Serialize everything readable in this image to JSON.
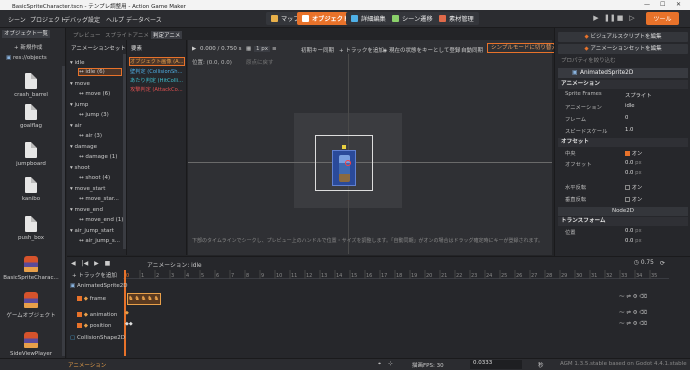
{
  "window": {
    "title": "BasicSpriteCharacter.tscn - テンプレ調整用 - Action Game Maker"
  },
  "menu": [
    "シーン",
    "プロジェクト",
    "デバッグ",
    "設定",
    "ヘルプ",
    "データベース"
  ],
  "top_tabs": [
    {
      "label": "マップ",
      "color": "#e8b04a"
    },
    {
      "label": "オブジェクト",
      "color": "#ffffff",
      "active": true
    },
    {
      "label": "詳細編集",
      "color": "#4fb0e6"
    },
    {
      "label": "シーン遷移",
      "color": "#8ad06a"
    },
    {
      "label": "素材管理",
      "color": "#e06a4a"
    }
  ],
  "run_button": "ツール",
  "left_dock": {
    "tab": "オブジェクト一覧",
    "new_button": "+ 新規作成",
    "path": "res://objects",
    "objects": [
      "crash_barrel",
      "goalflag",
      "jumpboard",
      "kanibo",
      "push_box",
      "BasicSpriteCharac...",
      "ゲームオブジェクト",
      "SideViewPlayer"
    ]
  },
  "sub_tabs": [
    "プレビュー",
    "スプライトアニメ",
    "判定アニメ"
  ],
  "animset": {
    "header": "アニメーションセット",
    "groups": [
      {
        "name": "idle",
        "item": "idle (6)",
        "selected": true
      },
      {
        "name": "move",
        "item": "move (6)"
      },
      {
        "name": "jump",
        "item": "jump (3)"
      },
      {
        "name": "air",
        "item": "air (3)"
      },
      {
        "name": "damage",
        "item": "damage (1)"
      },
      {
        "name": "shoot",
        "item": "shoot (4)"
      },
      {
        "name": "move_start",
        "item": "move_star..."
      },
      {
        "name": "move_end",
        "item": "move_end (1)"
      },
      {
        "name": "air_jump_start",
        "item": "air_jump_s..."
      }
    ]
  },
  "elements": {
    "header": "要素",
    "rows": [
      {
        "label": "オブジェクト画像 (A...",
        "color": "#e8a04a",
        "selected": true
      },
      {
        "label": "壁判定 (CollisionSh...",
        "color": "#4fb0e6"
      },
      {
        "label": "あたり判定 (HitColli...",
        "color": "#3ec0d0"
      },
      {
        "label": "攻撃判定 (AttackCo...",
        "color": "#e05050"
      }
    ]
  },
  "viewport": {
    "time": "0.000 / 0.750 s",
    "px": "1 px",
    "init_sync": "初期キー同期",
    "add_track": "+ トラックを追加",
    "register_key": "現在の状態をキーとして登録",
    "auto_sync": "自動同期",
    "simple_mode": "シンプルモードに切り替え",
    "position_label": "位置:",
    "position_value": "(0.0, 0.0)",
    "reset": "原点に戻す",
    "hint": "下部のタイムラインでシークし、プレビュー上のハンドルで位置・サイズを調整します。「自動同期」がオンの場合はドラッグ確定時にキーが登録されます。"
  },
  "right_dock": {
    "visual_script": "ビジュアルスクリプトを編集",
    "animset_edit": "アニメーションセットを編集",
    "filter": "プロパティを絞り込む",
    "node": "AnimatedSprite2D",
    "sections": {
      "animation": "アニメーション",
      "offset": "オフセット",
      "node2d": "Node2D",
      "transform": "トランスフォーム"
    },
    "props": {
      "sprite_frames_label": "Sprite Frames",
      "sprite_frames": "スプライト",
      "animation_label": "アニメーション",
      "animation": "idle",
      "frame_label": "フレーム",
      "frame": "0",
      "speed_label": "スピードスケール",
      "speed": "1.0",
      "center_label": "中央",
      "center": "オン",
      "offset_label": "オフセット",
      "offset_x": "0.0",
      "offset_y": "0.0",
      "fliph_label": "水平反転",
      "fliph": "オン",
      "flipv_label": "垂直反転",
      "flipv": "オン",
      "pos_label": "位置",
      "pos_x": "0.0",
      "pos_y": "0.0",
      "unit": "px"
    }
  },
  "timeline": {
    "add_track": "+ トラックを追加",
    "anim_label": "アニメーション:",
    "anim_name": "idle",
    "length": "0.75",
    "ruler": [
      "0",
      "1",
      "2",
      "3",
      "4",
      "5",
      "6",
      "7",
      "8",
      "9",
      "10",
      "11",
      "12",
      "13",
      "14",
      "15",
      "16",
      "17",
      "18",
      "19",
      "20",
      "21",
      "22",
      "23",
      "24",
      "25",
      "26",
      "27",
      "28",
      "29",
      "30",
      "31",
      "32",
      "33",
      "34",
      "35"
    ],
    "tracks": [
      {
        "label": "AnimatedSprite2D",
        "indent": 0
      },
      {
        "label": "frame",
        "indent": 1
      },
      {
        "label": "animation",
        "indent": 1
      },
      {
        "label": "position",
        "indent": 1
      },
      {
        "label": "CollisionShape2D",
        "indent": 0
      }
    ]
  },
  "statusbar": {
    "left": "アニメーション",
    "fps_label": "描画FPS:",
    "fps": "30",
    "step": "0.0333",
    "unit": "秒",
    "version": "AGM 1.3.5.stable based on Godot 4.4.1.stable"
  }
}
